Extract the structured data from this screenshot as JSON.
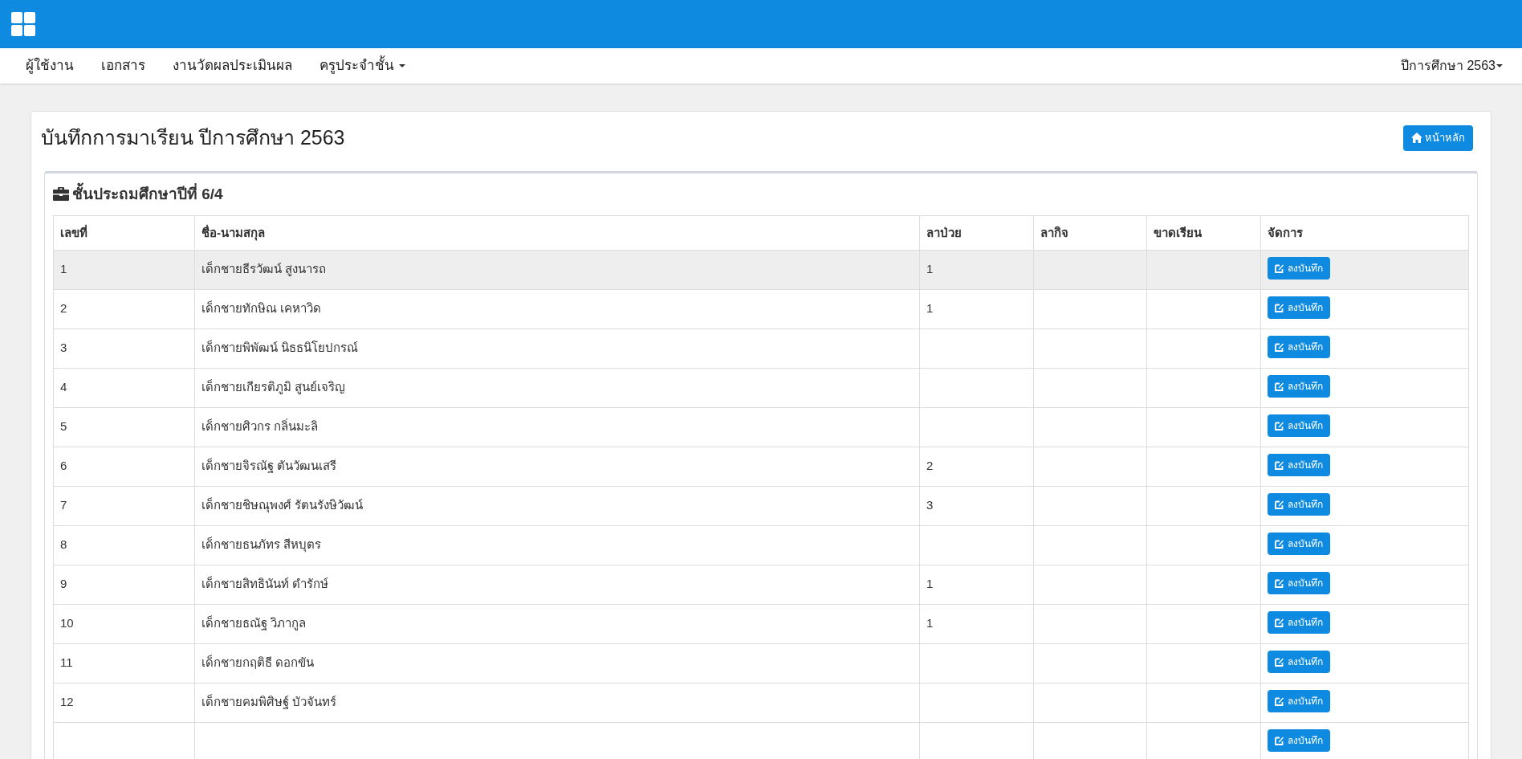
{
  "nav": {
    "items": [
      {
        "label": "ผู้ใช้งาน",
        "dropdown": false
      },
      {
        "label": "เอกสาร",
        "dropdown": false
      },
      {
        "label": "งานวัดผลประเมินผล",
        "dropdown": false
      },
      {
        "label": "ครูประจำชั้น",
        "dropdown": true
      }
    ],
    "year_menu": "ปีการศึกษา 2563"
  },
  "page": {
    "title": "บันทึกการมาเรียน ปีการศึกษา 2563",
    "home_button": "หน้าหลัก"
  },
  "panel": {
    "heading": "ชั้นประถมศึกษาปีที่ 6/4"
  },
  "table": {
    "columns": [
      "เลขที่",
      "ชื่อ-นามสกุล",
      "ลาป่วย",
      "ลากิจ",
      "ขาดเรียน",
      "จัดการ"
    ],
    "rows": [
      {
        "no": "1",
        "name": "เด็กชายธีรวัฒน์ สูงนารถ",
        "sick": "1",
        "highlighted": true,
        "action": "ลงบันทึก"
      },
      {
        "no": "2",
        "name": "เด็กชายทักษิณ เคหาวิด",
        "sick": "1",
        "highlighted": false,
        "action": "ลงบันทึก"
      },
      {
        "no": "3",
        "name": "เด็กชายพิพัฒน์ นิธธนิโยปกรณ์",
        "highlighted": false,
        "action": "ลงบันทึก"
      },
      {
        "no": "4",
        "name": "เด็กชายเกียรติภูมิ สูนย์เจริญ",
        "highlighted": false,
        "action": "ลงบันทึก"
      },
      {
        "no": "5",
        "name": "เด็กชายศิวกร กลิ่นมะลิ",
        "highlighted": false,
        "action": "ลงบันทึก"
      },
      {
        "no": "6",
        "name": "เด็กชายจิรณัฐ ตันวัฒนเสรี",
        "sick": "2",
        "highlighted": false,
        "action": "ลงบันทึก"
      },
      {
        "no": "7",
        "name": "เด็กชายชิษณุพงศ์ รัตนรังษิวัฒน์",
        "sick": "3",
        "highlighted": false,
        "action": "ลงบันทึก"
      },
      {
        "no": "8",
        "name": "เด็กชายธนภัทร สีหบุตร",
        "highlighted": false,
        "action": "ลงบันทึก"
      },
      {
        "no": "9",
        "name": "เด็กชายสิทธินันท์ ดำรักษ์",
        "sick": "1",
        "highlighted": false,
        "action": "ลงบันทึก"
      },
      {
        "no": "10",
        "name": "เด็กชายธณัฐ วิภากูล",
        "sick": "1",
        "highlighted": false,
        "action": "ลงบันทึก"
      },
      {
        "no": "11",
        "name": "เด็กชายกฤติธี ดอกขัน",
        "highlighted": false,
        "action": "ลงบันทึก"
      },
      {
        "no": "12",
        "name": "เด็กชายคมพิศิษฐ์ บัวจันทร์",
        "highlighted": false,
        "action": "ลงบันทึก"
      },
      {
        "highlighted": false,
        "action": "ลงบันทึก"
      }
    ]
  }
}
